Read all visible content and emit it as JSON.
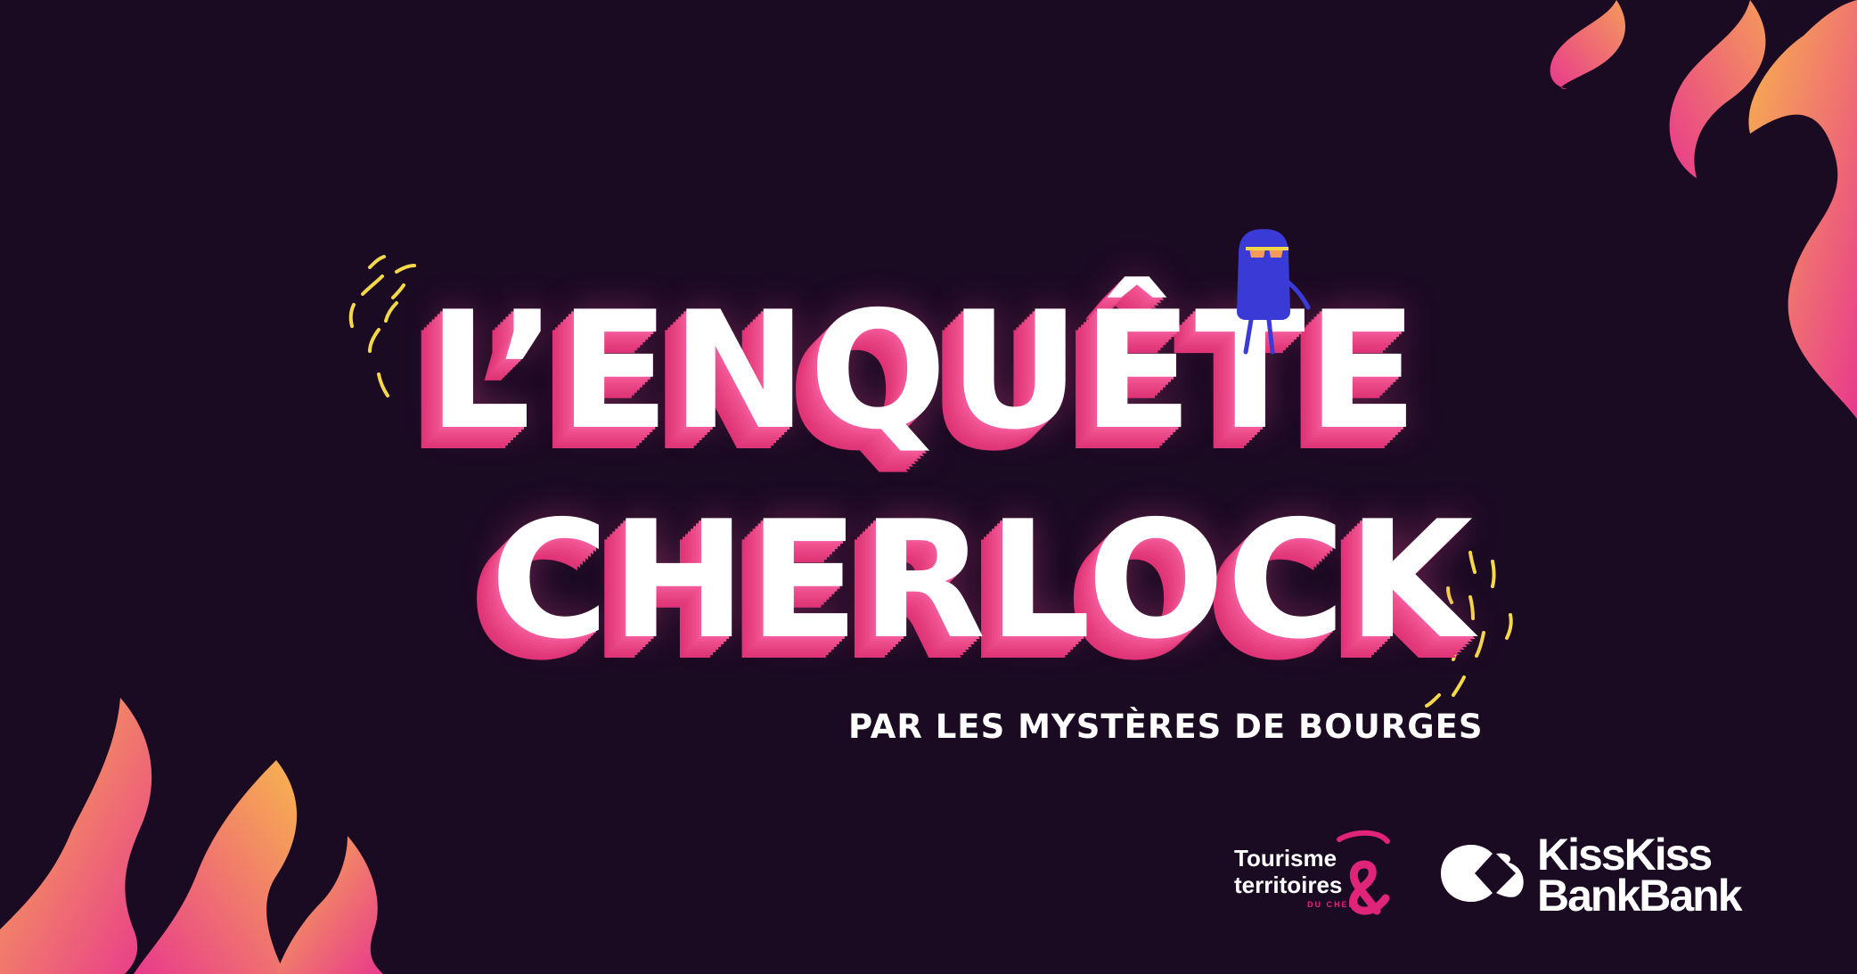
{
  "title": {
    "line1": "L’ENQUÊTE",
    "line2": "CHERLOCK"
  },
  "subtitle": "PAR LES MYSTÈRES DE BOURGES",
  "logos": {
    "tourisme": {
      "line1": "Tourisme",
      "line2": "territoires",
      "small": "DU CHER"
    },
    "kisskiss": {
      "line1": "KissKiss",
      "line2": "BankBank"
    }
  },
  "colors": {
    "background": "#1a0a22",
    "flame_start": "#f7b44f",
    "flame_end": "#e83a8c",
    "title_shadow": "#e43d7e",
    "character": "#3a3ad6",
    "doodle": "#f5d84a",
    "brand_pink": "#e0247a"
  },
  "icons": [
    "flame-icon",
    "character-icon",
    "doodle-icon",
    "ampersand-icon",
    "kisskiss-heart-icon"
  ]
}
